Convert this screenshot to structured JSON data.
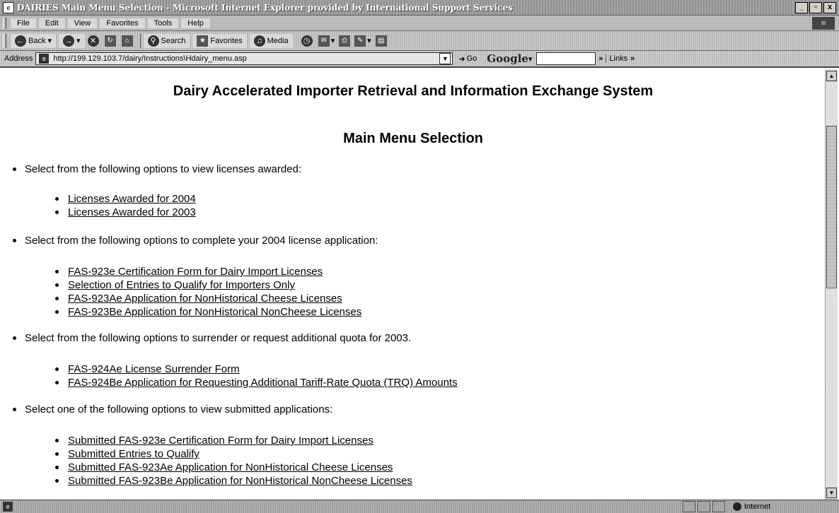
{
  "window": {
    "title": "DAIRIES Main Menu Selection - Microsoft Internet Explorer provided by International Support Services",
    "controls": [
      "_",
      "▫",
      "x"
    ]
  },
  "menu": [
    "File",
    "Edit",
    "View",
    "Favorites",
    "Tools",
    "Help"
  ],
  "toolbar": {
    "back": "Back",
    "search": "Search",
    "favorites": "Favorites",
    "media": "Media"
  },
  "address": {
    "label": "Address",
    "url": "http://199.129.103.7/dairy/Instructions\\Hdairy_menu.asp",
    "go": "Go",
    "google": "Google",
    "links": "Links"
  },
  "page": {
    "heading": "Dairy Accelerated Importer Retrieval and Information Exchange System",
    "subheading": "Main Menu Selection",
    "sections": [
      {
        "lead": "Select from the following options to view licenses awarded:",
        "links": [
          "Licenses Awarded for 2004",
          "Licenses Awarded for 2003"
        ]
      },
      {
        "lead": "Select from the following options to complete your 2004 license application:",
        "links": [
          "FAS-923e Certification Form for Dairy Import Licenses",
          "Selection of Entries to Qualify for Importers Only",
          "FAS-923Ae Application for NonHistorical Cheese Licenses",
          "FAS-923Be Application for NonHistorical NonCheese Licenses"
        ]
      },
      {
        "lead": "Select from the following options to surrender or request additional quota for 2003.",
        "links": [
          "FAS-924Ae License Surrender Form",
          "FAS-924Be Application for Requesting Additional Tariff-Rate Quota (TRQ) Amounts"
        ]
      },
      {
        "lead": "Select one of the following options to view submitted applications:",
        "links": [
          "Submitted FAS-923e Certification Form for Dairy Import Licenses",
          "Submitted Entries to Qualify",
          "Submitted FAS-923Ae Application for NonHistorical Cheese Licenses",
          "Submitted FAS-923Be Application for NonHistorical NonCheese Licenses"
        ]
      }
    ]
  },
  "status": {
    "zone": "Internet"
  }
}
